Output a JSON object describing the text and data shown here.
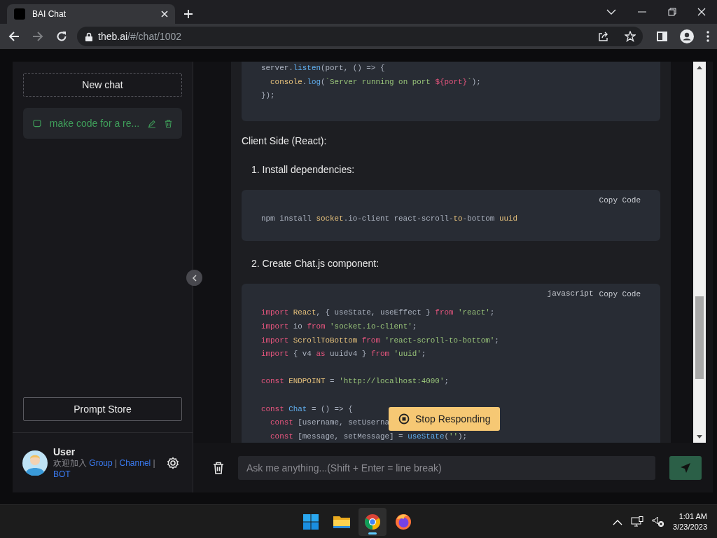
{
  "browser": {
    "tab_title": "BAI Chat",
    "host": "theb.ai",
    "path": "/#/chat/1002",
    "forward_disabled": true
  },
  "sidebar": {
    "new_chat": "New chat",
    "chats": [
      {
        "title": "make code for a re...",
        "selected": true
      }
    ],
    "prompt_store": "Prompt Store",
    "user": {
      "name": "User",
      "welcome": "欢迎加入",
      "links": [
        {
          "label": "Group",
          "sep": "|"
        },
        {
          "label": "Channel",
          "sep": "|"
        },
        {
          "label": "BOT"
        }
      ]
    }
  },
  "chat": {
    "blocks": [
      {
        "kind": "code",
        "lines": [
          {
            "tokens": [
              {
                "kind": "plain",
                "text": "server."
              },
              {
                "kind": "func",
                "text": "listen"
              },
              {
                "kind": "plain",
                "text": "(port, () => {"
              }
            ]
          },
          {
            "tokens": [
              {
                "kind": "name",
                "text": "  console"
              },
              {
                "kind": "plain",
                "text": "."
              },
              {
                "kind": "func",
                "text": "log"
              },
              {
                "kind": "plain",
                "text": "("
              },
              {
                "kind": "str",
                "text": "`Server running on port "
              },
              {
                "kind": "kw",
                "text": "${port}"
              },
              {
                "kind": "str",
                "text": "`"
              },
              {
                "kind": "plain",
                "text": ");"
              }
            ]
          },
          {
            "tokens": [
              {
                "kind": "plain",
                "text": "});"
              }
            ]
          }
        ]
      },
      {
        "kind": "text",
        "text": "Client Side (React):"
      },
      {
        "kind": "step",
        "text": "1. Install dependencies:"
      },
      {
        "kind": "code",
        "header": [
          {
            "kind": "copy",
            "text": "Copy Code"
          }
        ],
        "lines": [
          {
            "tokens": [
              {
                "kind": "plain",
                "text": "npm install "
              },
              {
                "kind": "name",
                "text": "socket"
              },
              {
                "kind": "plain",
                "text": ".io-client react-scroll-"
              },
              {
                "kind": "name",
                "text": "to"
              },
              {
                "kind": "plain",
                "text": "-bottom "
              },
              {
                "kind": "name",
                "text": "uuid"
              }
            ]
          }
        ]
      },
      {
        "kind": "step",
        "text": "2. Create Chat.js component:"
      },
      {
        "kind": "code",
        "header": [
          {
            "kind": "language",
            "text": "javascript"
          },
          {
            "kind": "copy",
            "text": "Copy Code"
          }
        ],
        "lines": [
          {
            "tokens": [
              {
                "kind": "kw",
                "text": "import "
              },
              {
                "kind": "name",
                "text": "React"
              },
              {
                "kind": "plain",
                "text": ", { useState, useEffect } "
              },
              {
                "kind": "kw",
                "text": "from "
              },
              {
                "kind": "str",
                "text": "'react'"
              },
              {
                "kind": "plain",
                "text": ";"
              }
            ]
          },
          {
            "tokens": [
              {
                "kind": "kw",
                "text": "import"
              },
              {
                "kind": "plain",
                "text": " io "
              },
              {
                "kind": "kw",
                "text": "from "
              },
              {
                "kind": "str",
                "text": "'socket.io-client'"
              },
              {
                "kind": "plain",
                "text": ";"
              }
            ]
          },
          {
            "tokens": [
              {
                "kind": "kw",
                "text": "import "
              },
              {
                "kind": "name",
                "text": "ScrollToBottom "
              },
              {
                "kind": "kw",
                "text": "from "
              },
              {
                "kind": "str",
                "text": "'react-scroll-to-bottom'"
              },
              {
                "kind": "plain",
                "text": ";"
              }
            ]
          },
          {
            "tokens": [
              {
                "kind": "kw",
                "text": "import"
              },
              {
                "kind": "plain",
                "text": " { v4 "
              },
              {
                "kind": "kw",
                "text": "as"
              },
              {
                "kind": "plain",
                "text": " uuidv4 } "
              },
              {
                "kind": "kw",
                "text": "from "
              },
              {
                "kind": "str",
                "text": "'uuid'"
              },
              {
                "kind": "plain",
                "text": ";"
              }
            ]
          },
          {
            "tokens": [
              {
                "kind": "kw",
                "text": "const "
              },
              {
                "kind": "name",
                "text": "ENDPOINT"
              },
              {
                "kind": "plain",
                "text": " = "
              },
              {
                "kind": "str",
                "text": "'http://localhost:4000'"
              },
              {
                "kind": "plain",
                "text": ";"
              }
            ],
            "gap_before": true
          },
          {
            "tokens": [
              {
                "kind": "kw",
                "text": "const "
              },
              {
                "kind": "func",
                "text": "Chat"
              },
              {
                "kind": "plain",
                "text": " = () => {"
              }
            ],
            "gap_before": true
          },
          {
            "tokens": [
              {
                "kind": "kw",
                "text": "  const"
              },
              {
                "kind": "plain",
                "text": " [username, setUserna"
              }
            ]
          },
          {
            "tokens": [
              {
                "kind": "kw",
                "text": "  const"
              },
              {
                "kind": "plain",
                "text": " [message, setMessage] = "
              },
              {
                "kind": "func",
                "text": "useState"
              },
              {
                "kind": "plain",
                "text": "("
              },
              {
                "kind": "str",
                "text": "''"
              },
              {
                "kind": "plain",
                "text": ");"
              }
            ]
          }
        ]
      }
    ],
    "stop_button": "Stop Responding",
    "input": {
      "placeholder": "Ask me anything...(Shift + Enter = line break)"
    }
  },
  "taskbar": {
    "apps": [
      {
        "kind": "start",
        "selected": false
      },
      {
        "kind": "explorer",
        "selected": false
      },
      {
        "kind": "chrome",
        "selected": true
      },
      {
        "kind": "firefox",
        "selected": false
      }
    ],
    "time": "1:01 AM",
    "date": "3/23/2023"
  }
}
